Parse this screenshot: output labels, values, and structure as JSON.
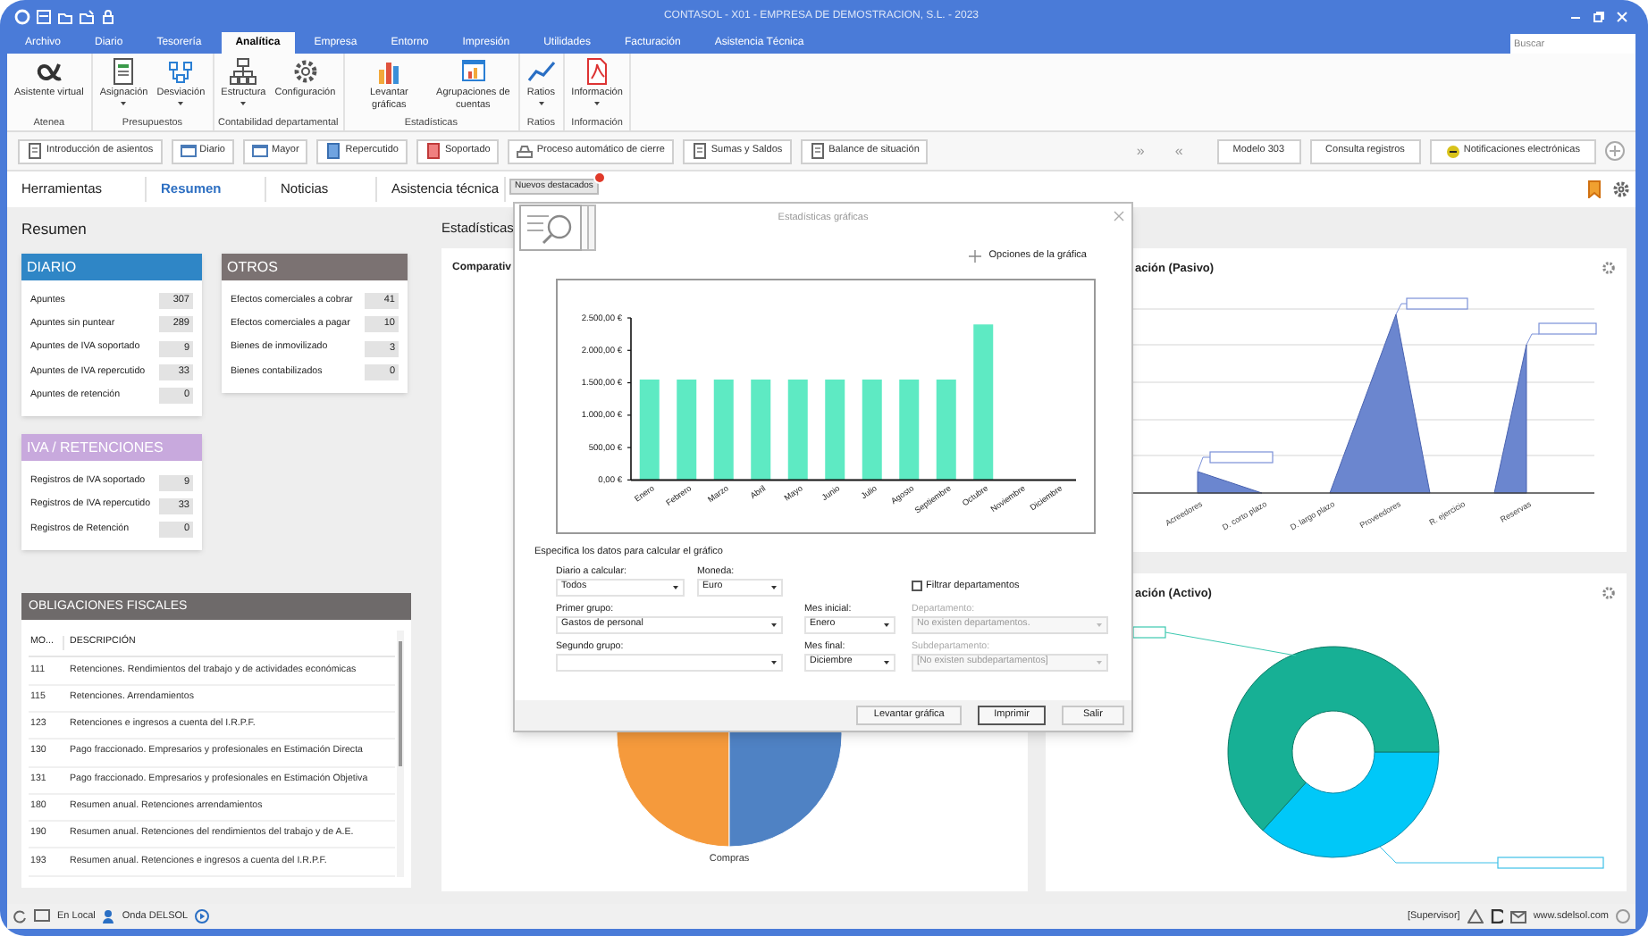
{
  "window": {
    "title": "CONTASOL - X01 - EMPRESA DE DEMOSTRACION, S.L. - 2023"
  },
  "menu_tabs": [
    {
      "label": "Archivo",
      "selected": false
    },
    {
      "label": "Diario",
      "selected": false
    },
    {
      "label": "Tesorería",
      "selected": false
    },
    {
      "label": "Analítica",
      "selected": true
    },
    {
      "label": "Empresa",
      "selected": false
    },
    {
      "label": "Entorno",
      "selected": false
    },
    {
      "label": "Impresión",
      "selected": false
    },
    {
      "label": "Utilidades",
      "selected": false
    },
    {
      "label": "Facturación",
      "selected": false
    },
    {
      "label": "Asistencia Técnica",
      "selected": false
    }
  ],
  "search": {
    "placeholder": "Buscar"
  },
  "ribbon_groups": [
    {
      "label": "Atenea",
      "buttons": [
        {
          "label": "Asistente virtual",
          "dropdown": false
        }
      ]
    },
    {
      "label": "Presupuestos",
      "buttons": [
        {
          "label": "Asignación",
          "dropdown": true
        },
        {
          "label": "Desviación",
          "dropdown": true
        }
      ]
    },
    {
      "label": "Contabilidad departamental",
      "buttons": [
        {
          "label": "Estructura",
          "dropdown": true
        },
        {
          "label": "Configuración",
          "dropdown": false
        }
      ]
    },
    {
      "label": "Estadísticas",
      "buttons": [
        {
          "label": "Levantar gráficas",
          "dropdown": false
        },
        {
          "label": "Agrupaciones de cuentas",
          "dropdown": false
        }
      ]
    },
    {
      "label": "Ratios",
      "buttons": [
        {
          "label": "Ratios",
          "dropdown": true
        }
      ]
    },
    {
      "label": "Información",
      "buttons": [
        {
          "label": "Información",
          "dropdown": true
        }
      ]
    }
  ],
  "toolbar": {
    "left": [
      {
        "label": "Introducción de asientos"
      },
      {
        "label": "Diario"
      },
      {
        "label": "Mayor"
      },
      {
        "label": "Repercutido"
      },
      {
        "label": "Soportado"
      },
      {
        "label": "Proceso automático de cierre"
      },
      {
        "label": "Sumas y Saldos"
      },
      {
        "label": "Balance de situación"
      }
    ],
    "scroll_right": "»",
    "scroll_left": "«",
    "right": [
      {
        "label": "Modelo 303"
      },
      {
        "label": "Consulta registros"
      },
      {
        "label": "Notificaciones electrónicas"
      }
    ]
  },
  "nav_tabs": [
    {
      "label": "Herramientas",
      "selected": false
    },
    {
      "label": "Resumen",
      "selected": true
    },
    {
      "label": "Noticias",
      "selected": false
    },
    {
      "label": "Asistencia técnica",
      "selected": false
    }
  ],
  "featured_button": {
    "label": "Nuevos destacados"
  },
  "summary": {
    "title": "Resumen",
    "panels": [
      {
        "title": "DIARIO",
        "color": "#2f86c6",
        "rows": [
          {
            "label": "Apuntes",
            "value": "307"
          },
          {
            "label": "Apuntes sin puntear",
            "value": "289"
          },
          {
            "label": "Apuntes de IVA soportado",
            "value": "9"
          },
          {
            "label": "Apuntes de IVA repercutido",
            "value": "33"
          },
          {
            "label": "Apuntes de retención",
            "value": "0"
          }
        ]
      },
      {
        "title": "OTROS",
        "color": "#7b7272",
        "rows": [
          {
            "label": "Efectos comerciales a cobrar",
            "value": "41"
          },
          {
            "label": "Efectos comerciales a pagar",
            "value": "10"
          },
          {
            "label": "Bienes de inmovilizado",
            "value": "3"
          },
          {
            "label": "Bienes contabilizados",
            "value": "0"
          }
        ]
      },
      {
        "title": "IVA / RETENCIONES",
        "color": "#c8a9dd",
        "rows": [
          {
            "label": "Registros de IVA soportado",
            "value": "9"
          },
          {
            "label": "Registros de IVA repercutido",
            "value": "33"
          },
          {
            "label": "Registros de Retención",
            "value": "0"
          }
        ]
      }
    ]
  },
  "obligations": {
    "title": "OBLIGACIONES FISCALES",
    "columns": [
      "MO...",
      "DESCRIPCIÓN"
    ],
    "rows": [
      {
        "code": "111",
        "description": "Retenciones. Rendimientos del trabajo y de actividades económicas"
      },
      {
        "code": "115",
        "description": "Retenciones. Arrendamientos"
      },
      {
        "code": "123",
        "description": "Retenciones e ingresos a cuenta del I.R.P.F."
      },
      {
        "code": "130",
        "description": "Pago fraccionado. Empresarios y profesionales en Estimación Directa"
      },
      {
        "code": "131",
        "description": "Pago fraccionado. Empresarios y profesionales en Estimación Objetiva"
      },
      {
        "code": "180",
        "description": "Resumen anual. Retenciones arrendamientos"
      },
      {
        "code": "190",
        "description": "Resumen anual. Retenciones del rendimientos del trabajo y de A.E."
      },
      {
        "code": "193",
        "description": "Resumen anual. Retenciones e ingresos a cuenta del I.R.P.F."
      }
    ]
  },
  "statistics": {
    "title": "Estadísticas",
    "comparison_card": {
      "title": "Comparativ",
      "pie_label": "Compras"
    },
    "liabilities_card": {
      "title": "ación (Pasivo)",
      "categories": [
        "Acreedores",
        "D. corto plazo",
        "D. largo plazo",
        "Proveedores",
        "R. ejercicio",
        "Reservas"
      ]
    },
    "assets_card": {
      "title": "ación (Activo)"
    }
  },
  "dialog": {
    "title": "Estadísticas gráficas",
    "options_link": "Opciones de la gráfica",
    "chart_data": {
      "type": "bar",
      "categories": [
        "Enero",
        "Febrero",
        "Marzo",
        "Abril",
        "Mayo",
        "Junio",
        "Julio",
        "Agosto",
        "Septiembre",
        "Octubre",
        "Noviembre",
        "Diciembre"
      ],
      "values": [
        1550,
        1550,
        1550,
        1550,
        1550,
        1550,
        1550,
        1550,
        1550,
        2400,
        0,
        0
      ],
      "ylim": [
        0,
        2500
      ],
      "yticks": [
        {
          "value": 0,
          "label": "0,00 €"
        },
        {
          "value": 500,
          "label": "500,00 €"
        },
        {
          "value": 1000,
          "label": "1.000,00 €"
        },
        {
          "value": 1500,
          "label": "1.500,00 €"
        },
        {
          "value": 2000,
          "label": "2.000,00 €"
        },
        {
          "value": 2500,
          "label": "2.500,00 €"
        }
      ]
    },
    "instructions": "Especifica los datos para calcular el gráfico",
    "fields": [
      {
        "label": "Diario a calcular:",
        "value": "Todos",
        "disabled": false
      },
      {
        "label": "Moneda:",
        "value": "Euro",
        "disabled": false
      },
      {
        "label": "Primer grupo:",
        "value": "Gastos de personal",
        "disabled": false
      },
      {
        "label": "Mes inicial:",
        "value": "Enero",
        "disabled": false
      },
      {
        "label": "Departamento:",
        "value": "No existen departamentos.",
        "disabled": true
      },
      {
        "label": "Segundo grupo:",
        "disabled": false
      },
      {
        "label": "Mes final:",
        "value": "Diciembre",
        "disabled": false
      },
      {
        "label": "Subdepartamento:",
        "value": "[No existen subdepartamentos]",
        "disabled": true
      }
    ],
    "filter_departments": {
      "label": "Filtrar departamentos",
      "checked": false
    },
    "buttons": [
      {
        "label": "Levantar gráfica",
        "focused": false
      },
      {
        "label": "Imprimir",
        "focused": true
      },
      {
        "label": "Salir",
        "focused": false
      }
    ]
  },
  "status_bar": {
    "location": "En Local",
    "radio": "Onda DELSOL",
    "user": "[Supervisor]",
    "website": "www.sdelsol.com"
  }
}
